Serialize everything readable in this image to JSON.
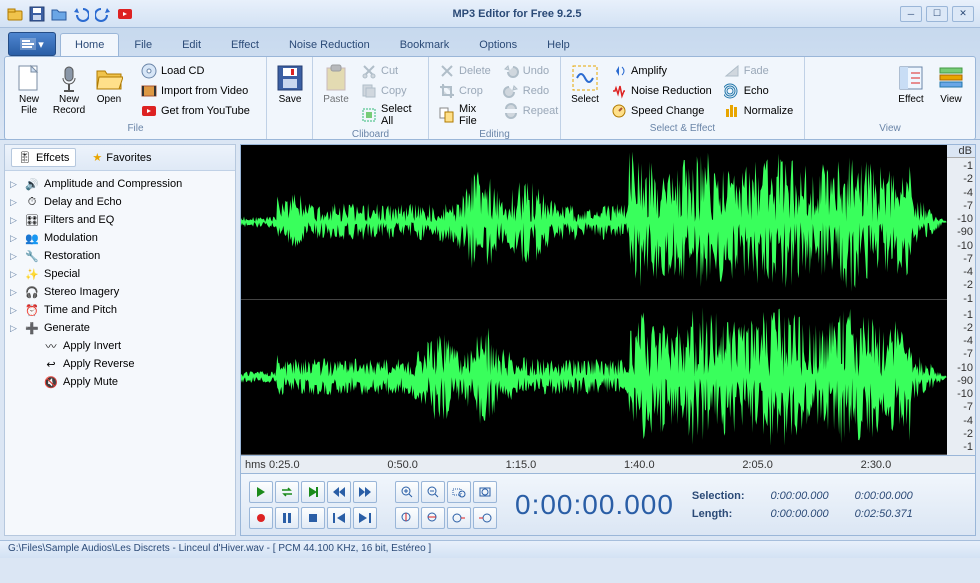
{
  "title": "MP3 Editor for Free 9.2.5",
  "tabs": [
    "Home",
    "File",
    "Edit",
    "Effect",
    "Noise Reduction",
    "Bookmark",
    "Options",
    "Help"
  ],
  "active_tab": "Home",
  "ribbon": {
    "file": {
      "name": "File",
      "new_file": "New File",
      "new_record": "New Record",
      "open": "Open",
      "load_cd": "Load CD",
      "import_video": "Import from Video",
      "youtube": "Get from YouTube"
    },
    "save": "Save",
    "clipboard": {
      "name": "Cliboard",
      "paste": "Paste",
      "cut": "Cut",
      "copy": "Copy",
      "select_all": "Select All"
    },
    "editing": {
      "name": "Editing",
      "del": "Delete",
      "crop": "Crop",
      "mix": "Mix File",
      "undo": "Undo",
      "redo": "Redo",
      "repeat": "Repeat"
    },
    "selecteffect": {
      "name": "Select & Effect",
      "select": "Select",
      "amplify": "Amplify",
      "noise": "Noise Reduction",
      "speed": "Speed Change",
      "fade": "Fade",
      "echo": "Echo",
      "normalize": "Normalize"
    },
    "view": {
      "name": "View",
      "effect": "Effect",
      "view": "View"
    }
  },
  "sidebar": {
    "tab_effects": "Effcets",
    "tab_favorites": "Favorites",
    "items": [
      {
        "label": "Amplitude and Compression",
        "exp": true
      },
      {
        "label": "Delay and Echo",
        "exp": true
      },
      {
        "label": "Filters and EQ",
        "exp": true
      },
      {
        "label": "Modulation",
        "exp": true
      },
      {
        "label": "Restoration",
        "exp": true
      },
      {
        "label": "Special",
        "exp": true
      },
      {
        "label": "Stereo Imagery",
        "exp": true
      },
      {
        "label": "Time and Pitch",
        "exp": true
      },
      {
        "label": "Generate",
        "exp": true
      },
      {
        "label": "Apply Invert",
        "exp": false
      },
      {
        "label": "Apply Reverse",
        "exp": false
      },
      {
        "label": "Apply Mute",
        "exp": false
      }
    ]
  },
  "db_header": "dB",
  "db_ticks": [
    "-1",
    "-2",
    "-4",
    "-7",
    "-10",
    "-90",
    "-10",
    "-7",
    "-4",
    "-2",
    "-1"
  ],
  "timeline": {
    "unit": "hms",
    "marks": [
      "0:25.0",
      "0:50.0",
      "1:15.0",
      "1:40.0",
      "2:05.0",
      "2:30.0"
    ]
  },
  "transport": {
    "timecode": "0:00:00.000"
  },
  "info": {
    "sel_label": "Selection:",
    "sel_start": "0:00:00.000",
    "sel_end": "0:00:00.000",
    "len_label": "Length:",
    "len_start": "0:00:00.000",
    "len_end": "0:02:50.371"
  },
  "status": "G:\\Files\\Sample Audios\\Les Discrets - Linceul d'Hiver.wav - [ PCM 44.100 KHz, 16 bit, Estéreo ]"
}
